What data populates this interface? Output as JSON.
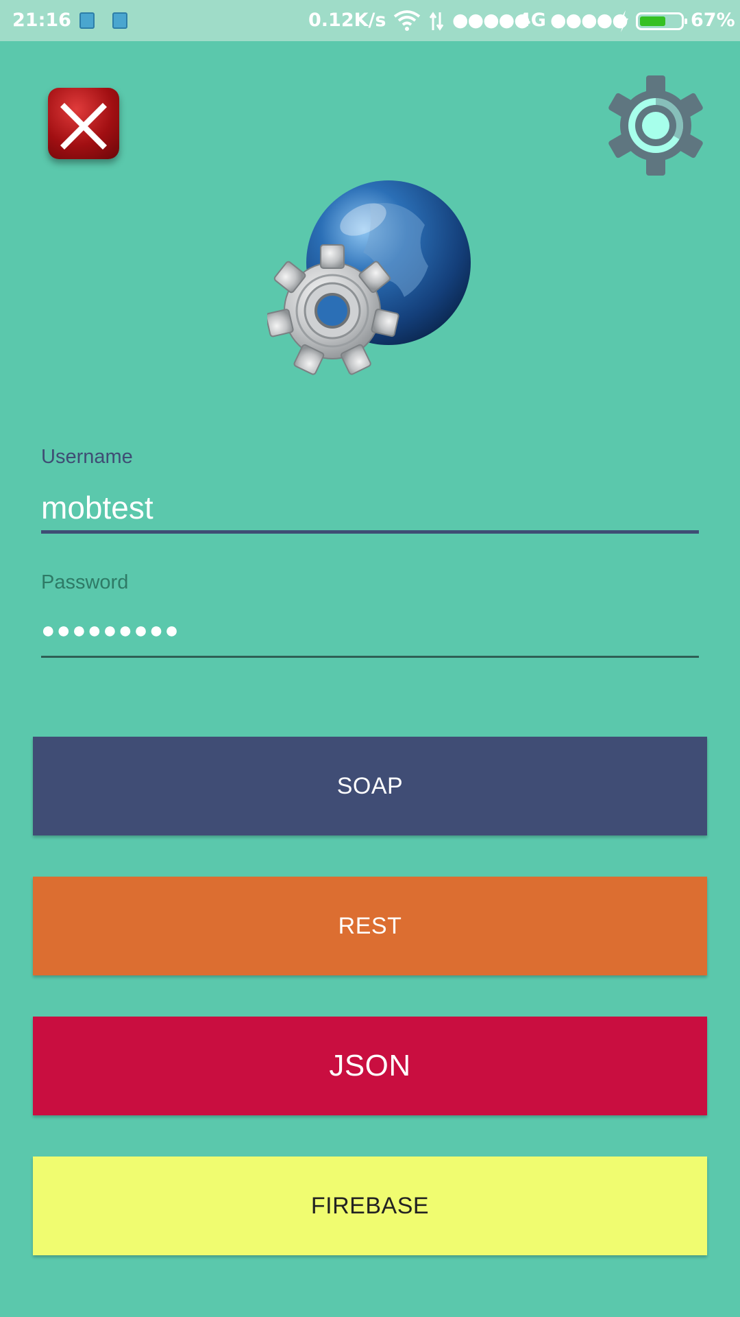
{
  "status_bar": {
    "time": "21:16",
    "network_speed": "0.12K/s",
    "signal_1": "●●●●●",
    "network_type": "4G",
    "signal_2": "●●●●●",
    "battery_percent": "67%",
    "battery_level": 0.67,
    "icons": [
      "sim-card-icon",
      "sim-card-icon",
      "wifi-icon",
      "data-transfer-icon",
      "charging-bolt-icon",
      "battery-icon"
    ]
  },
  "header": {
    "close_icon": "close-icon",
    "settings_icon": "settings-gear-icon"
  },
  "logo": {
    "icon": "globe-gear-logo"
  },
  "form": {
    "username": {
      "label": "Username",
      "value": "mobtest"
    },
    "password": {
      "label": "Password",
      "value": "●●●●●●●●●"
    }
  },
  "buttons": {
    "soap": "SOAP",
    "rest": "REST",
    "json": "JSON",
    "firebase": "FIREBASE"
  },
  "colors": {
    "background": "#5BC8AC",
    "status_bar": "#9FDCC8",
    "soap": "#404D75",
    "rest": "#DC6E31",
    "json": "#C90E40",
    "firebase": "#F0FC70",
    "close": "#A10F12",
    "settings_gear": "#5F7680",
    "settings_accent": "#A7FFEB"
  }
}
